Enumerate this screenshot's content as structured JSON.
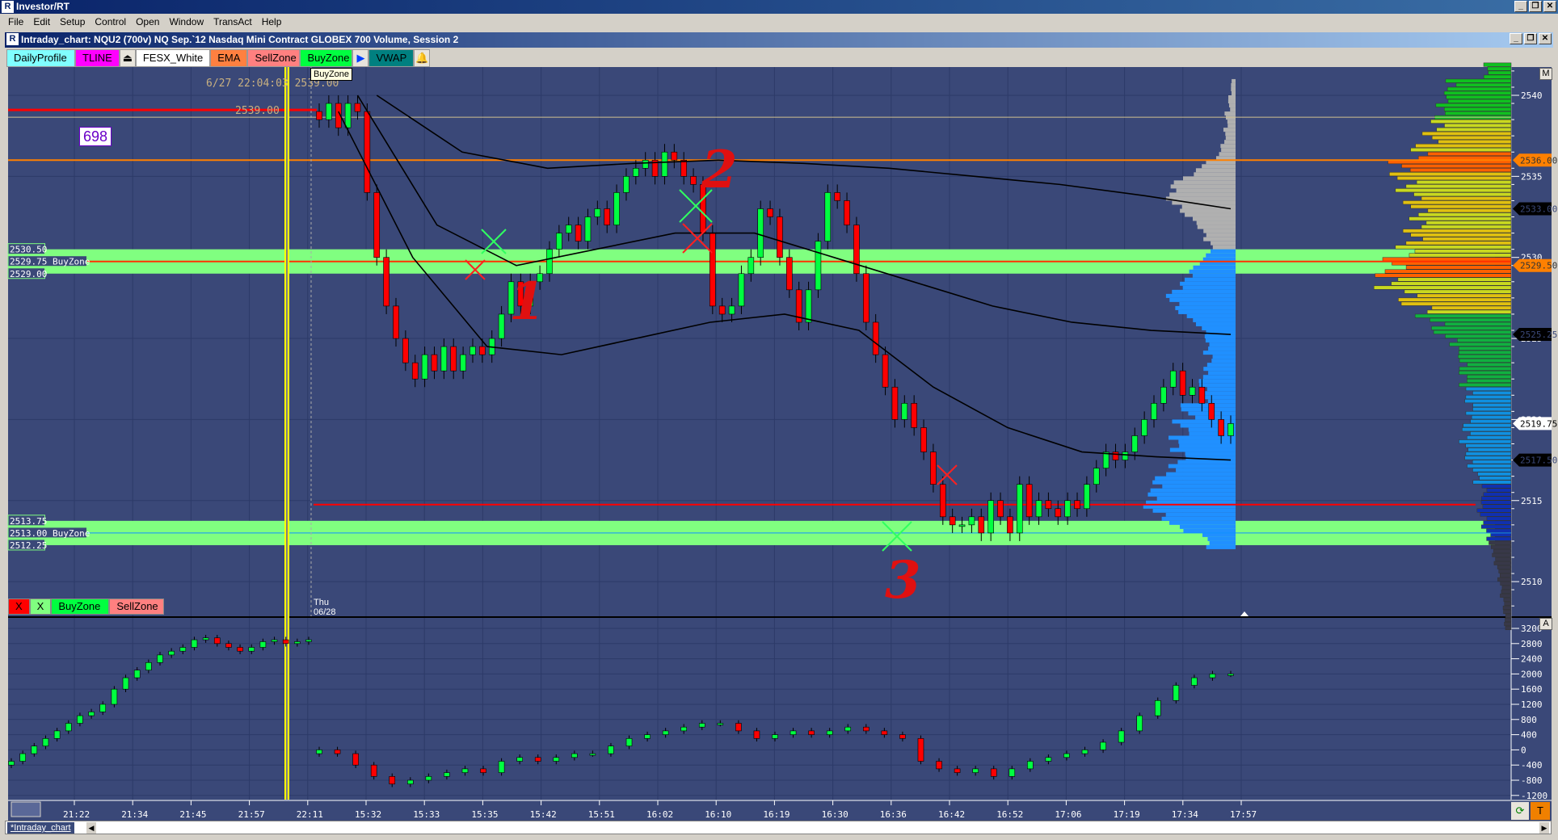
{
  "app": {
    "title": "Investor/RT",
    "icon": "R"
  },
  "window_controls": [
    "_",
    "❐",
    "✕"
  ],
  "menu": [
    "File",
    "Edit",
    "Setup",
    "Control",
    "Open",
    "Window",
    "TransAct",
    "Help"
  ],
  "chart_window": {
    "title": "Intraday_chart: NQU2 (700v) NQ Sep.`12 Nasdaq Mini Contract GLOBEX 700 Volume, Session 2"
  },
  "toolbar": [
    {
      "label": "DailyProfile",
      "bg": "#80ffff",
      "fg": "#000000"
    },
    {
      "label": "TLINE",
      "bg": "#ff00ff",
      "fg": "#000000"
    },
    {
      "label": "FESX_White",
      "bg": "#ffffff",
      "fg": "#000000"
    },
    {
      "label": "EMA",
      "bg": "#ff8040",
      "fg": "#000000"
    },
    {
      "label": "SellZone",
      "bg": "#ff8080",
      "fg": "#000000"
    },
    {
      "label": "BuyZone",
      "bg": "#00ff40",
      "fg": "#000000"
    },
    {
      "label": "VWAP",
      "bg": "#008080",
      "fg": "#000000"
    }
  ],
  "tooltip": "BuyZone",
  "counter": "698",
  "top_annotation": "6/27 22:04:03 2539.00",
  "red_line_label": "2539.00",
  "zone_labels": [
    {
      "text": "2530.50",
      "price": 2530.5
    },
    {
      "text": "2529.75 BuyZone",
      "price": 2529.75
    },
    {
      "text": "2529.00",
      "price": 2529.0
    },
    {
      "text": "2513.75",
      "price": 2513.75
    },
    {
      "text": "2513.00 BuyZone",
      "price": 2513.0
    },
    {
      "text": "2512.25",
      "price": 2512.25
    }
  ],
  "zone_bar": [
    {
      "label": "X",
      "bg": "#ff0000"
    },
    {
      "label": "X",
      "bg": "#80ff80"
    },
    {
      "label": "BuyZone",
      "bg": "#00ff40"
    },
    {
      "label": "SellZone",
      "bg": "#ff8080"
    }
  ],
  "date_marker": {
    "day": "Thu",
    "date": "06/28"
  },
  "handwritten": [
    "1",
    "2",
    "3"
  ],
  "colors": {
    "bg": "#3a4878",
    "grid": "#2c3a68",
    "up": "#00ff40",
    "down": "#ff0000",
    "buyzone": "#80ff80",
    "orange": "#ff8000"
  },
  "price_axis": {
    "labels": [
      "2540",
      "2535",
      "2530",
      "2525",
      "2520",
      "2515",
      "2510"
    ],
    "values": [
      2540,
      2535,
      2530,
      2525,
      2520,
      2515,
      2510
    ]
  },
  "price_markers": [
    {
      "text": "2536.00",
      "price": 2536.0,
      "bg": "#ff8000",
      "fg": "#333333"
    },
    {
      "text": "2533.00",
      "price": 2533.0,
      "bg": "#000000",
      "fg": "#3a4878"
    },
    {
      "text": "2529.50",
      "price": 2529.5,
      "bg": "#ff8000",
      "fg": "#333333"
    },
    {
      "text": "2525.25",
      "price": 2525.25,
      "bg": "#000000",
      "fg": "#3a4878"
    },
    {
      "text": "2519.75",
      "price": 2519.75,
      "bg": "#ffffff",
      "fg": "#000000"
    },
    {
      "text": "2517.50",
      "price": 2517.5,
      "bg": "#000000",
      "fg": "#3a4878"
    }
  ],
  "lower_axis": {
    "labels": [
      "3200",
      "2800",
      "2400",
      "2000",
      "1600",
      "1200",
      "800",
      "400",
      "0",
      "-400",
      "-800",
      "-1200"
    ],
    "values": [
      3200,
      2800,
      2400,
      2000,
      1600,
      1200,
      800,
      400,
      0,
      -400,
      -800,
      -1200
    ]
  },
  "time_axis": [
    "21:22",
    "21:34",
    "21:45",
    "21:57",
    "22:11",
    "15:32",
    "15:33",
    "15:35",
    "15:42",
    "15:51",
    "16:02",
    "16:10",
    "16:19",
    "16:30",
    "16:36",
    "16:42",
    "16:52",
    "17:06",
    "17:19",
    "17:34",
    "17:57"
  ],
  "scale_buttons": {
    "main": "M",
    "lower": "A",
    "corner": "T"
  },
  "tab": "*Intraday_chart",
  "chart_data": {
    "type": "candlestick",
    "symbol": "NQU2",
    "closes": [
      2538.5,
      2539.5,
      2538,
      2539.5,
      2539,
      2534,
      2530,
      2527,
      2525,
      2523.5,
      2522.5,
      2524,
      2523,
      2524.5,
      2523,
      2524,
      2524.5,
      2524,
      2525,
      2526.5,
      2528.5,
      2527,
      2528.5,
      2529,
      2530.5,
      2531.5,
      2532,
      2531,
      2532.5,
      2533,
      2532,
      2534,
      2535,
      2535.5,
      2536,
      2535,
      2536.5,
      2536,
      2535,
      2534.5,
      2531.5,
      2527,
      2526.5,
      2527,
      2529,
      2530,
      2533,
      2532.5,
      2530,
      2528,
      2526,
      2528,
      2531,
      2534,
      2533.5,
      2532,
      2529,
      2526,
      2524,
      2522,
      2520,
      2521,
      2519.5,
      2518,
      2516,
      2514,
      2513.5,
      2513.5,
      2514,
      2513,
      2515,
      2514,
      2513,
      2516,
      2514,
      2515,
      2514.5,
      2514,
      2515,
      2514.5,
      2516,
      2517,
      2518,
      2517.5,
      2518,
      2519,
      2520,
      2521,
      2522,
      2523,
      2521.5,
      2522,
      2521,
      2520,
      2519,
      2519.75
    ],
    "moving_averages": [
      {
        "name": "fast",
        "start_index": 2,
        "values": [
          2539,
          2530,
          2524.5,
          2524,
          2525,
          2526,
          2526.5,
          2525.5,
          2522,
          2519.5,
          2518,
          2517.7,
          2517.5
        ]
      },
      {
        "name": "mid",
        "start_index": 4,
        "values": [
          2540,
          2532,
          2529.5,
          2530.5,
          2531.5,
          2531.5,
          2530,
          2528.5,
          2527,
          2526,
          2525.5,
          2525.25
        ]
      },
      {
        "name": "slow",
        "start_index": 6,
        "values": [
          2540,
          2536.5,
          2535.5,
          2535.8,
          2536,
          2535.8,
          2535.5,
          2535,
          2534.5,
          2533.8,
          2533
        ]
      }
    ],
    "buy_zones": [
      [
        2529.0,
        2530.5
      ],
      [
        2512.25,
        2513.75
      ]
    ],
    "lines": {
      "orange": 2536.0,
      "red_zone": 2529.75,
      "red_left": 2539.0,
      "red_low": 2514.75,
      "blue_zone": 2513.0
    },
    "session_profile": {
      "top": 2541,
      "volumes": [
        5,
        8,
        12,
        15,
        22,
        45,
        70,
        75,
        60,
        45,
        35,
        50,
        60,
        75,
        65,
        45,
        40,
        35,
        40,
        35,
        60,
        70,
        85,
        75,
        90,
        95,
        100,
        80,
        40,
        0
      ]
    },
    "daily_profile": {
      "top": 2542,
      "volumes": [
        20,
        50,
        55,
        60,
        65,
        75,
        90,
        85,
        80,
        75,
        80,
        85,
        95,
        100,
        85,
        70,
        60,
        45,
        40,
        38,
        35,
        33,
        37,
        38,
        35,
        28,
        22,
        25,
        22,
        18,
        14,
        10,
        8,
        6,
        5
      ]
    },
    "lower_panel": {
      "pre_session": [
        -300,
        -100,
        100,
        300,
        500,
        700,
        900,
        1000,
        1200,
        1600,
        1900,
        2100,
        2300,
        2500,
        2600,
        2700,
        2900,
        2950,
        2800,
        2700,
        2600,
        2700,
        2850,
        2900,
        2800,
        2850,
        2900
      ],
      "session": [
        0,
        -100,
        -400,
        -700,
        -900,
        -800,
        -700,
        -600,
        -500,
        -600,
        -300,
        -200,
        -300,
        -200,
        -100,
        -100,
        100,
        300,
        400,
        500,
        600,
        700,
        700,
        500,
        300,
        400,
        500,
        400,
        500,
        600,
        500,
        400,
        300,
        -300,
        -500,
        -600,
        -500,
        -700,
        -500,
        -300,
        -200,
        -100,
        0,
        200,
        500,
        900,
        1300,
        1700,
        1900,
        2000,
        2000
      ],
      "ylim": [
        -1200,
        3200
      ]
    },
    "ylim": [
      2508,
      2542
    ]
  }
}
